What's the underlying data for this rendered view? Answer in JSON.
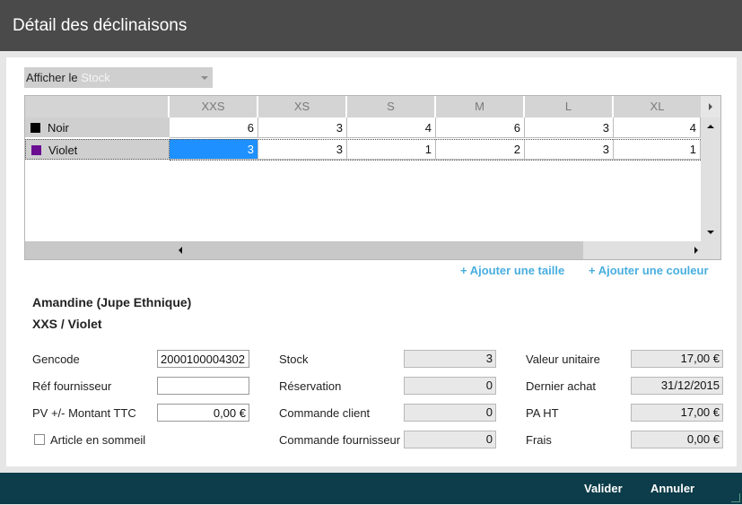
{
  "window": {
    "title": "Détail des déclinaisons"
  },
  "display_select": {
    "prefix": "Afficher le",
    "value": "Stock"
  },
  "grid": {
    "sizes": [
      "XXS",
      "XS",
      "S",
      "M",
      "L",
      "XL"
    ],
    "rows": [
      {
        "color_name": "Noir",
        "swatch": "#000000",
        "values": [
          "6",
          "3",
          "4",
          "6",
          "3",
          "4"
        ]
      },
      {
        "color_name": "Violet",
        "swatch": "#6a0d91",
        "values": [
          "3",
          "3",
          "1",
          "2",
          "3",
          "1"
        ]
      }
    ],
    "selected": {
      "row": 1,
      "col": 0
    }
  },
  "links": {
    "add_size": "+ Ajouter une taille",
    "add_color": "+ Ajouter une couleur"
  },
  "product": {
    "name": "Amandine (Jupe Ethnique)",
    "variant": "XXS / Violet"
  },
  "fields": {
    "gencode_label": "Gencode",
    "gencode_value": "2000100004302",
    "ref_label": "Réf fournisseur",
    "ref_value": "",
    "pv_label": "PV +/- Montant TTC",
    "pv_value": "0,00 €",
    "sleep_label": "Article en sommeil",
    "stock_label": "Stock",
    "stock_value": "3",
    "reservation_label": "Réservation",
    "reservation_value": "0",
    "cmd_client_label": "Commande client",
    "cmd_client_value": "0",
    "cmd_fourn_label": "Commande fournisseur",
    "cmd_fourn_value": "0",
    "unit_value_label": "Valeur unitaire",
    "unit_value_value": "17,00 €",
    "last_purchase_label": "Dernier achat",
    "last_purchase_value": "31/12/2015",
    "pa_ht_label": "PA HT",
    "pa_ht_value": "17,00 €",
    "frais_label": "Frais",
    "frais_value": "0,00 €"
  },
  "footer": {
    "validate": "Valider",
    "cancel": "Annuler"
  },
  "colors": {
    "titlebar": "#4a4a4a",
    "footer": "#0d3c4a",
    "link": "#48aee0",
    "selection": "#1e90ff"
  }
}
